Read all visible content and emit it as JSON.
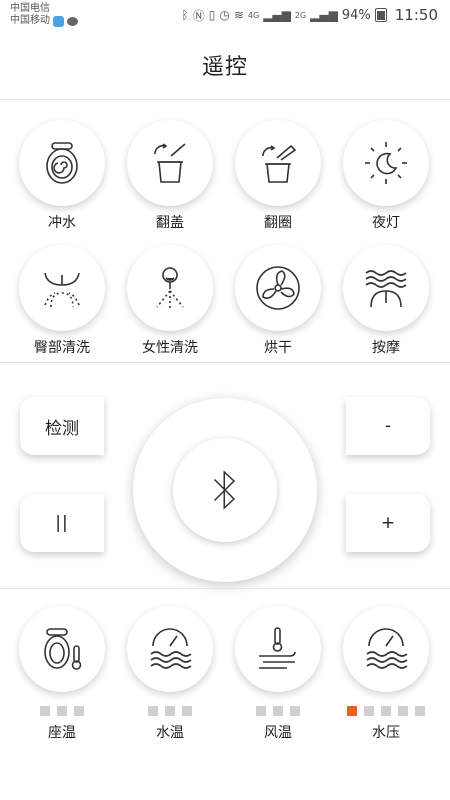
{
  "status_bar": {
    "carrier1": "中国电信",
    "carrier2": "中国移动",
    "network1": "4G",
    "network2": "2G",
    "battery": "94%",
    "time": "11:50"
  },
  "header": {
    "title": "遥控"
  },
  "functions": [
    {
      "label": "冲水",
      "icon": "flush-icon"
    },
    {
      "label": "翻盖",
      "icon": "lid-flip-icon"
    },
    {
      "label": "翻圈",
      "icon": "seat-flip-icon"
    },
    {
      "label": "夜灯",
      "icon": "night-light-icon"
    },
    {
      "label": "臀部清洗",
      "icon": "rear-wash-icon"
    },
    {
      "label": "女性清洗",
      "icon": "feminine-wash-icon"
    },
    {
      "label": "烘干",
      "icon": "fan-dry-icon"
    },
    {
      "label": "按摩",
      "icon": "massage-icon"
    }
  ],
  "controls": {
    "detect_label": "检测",
    "pause_label": "||",
    "minus_label": "-",
    "plus_label": "+",
    "center_icon": "bluetooth-icon"
  },
  "levels": [
    {
      "label": "座温",
      "icon": "seat-temp-icon",
      "max": 3,
      "level": 0
    },
    {
      "label": "水温",
      "icon": "water-temp-icon",
      "max": 3,
      "level": 0
    },
    {
      "label": "风温",
      "icon": "wind-temp-icon",
      "max": 3,
      "level": 0
    },
    {
      "label": "水压",
      "icon": "water-pressure-icon",
      "max": 5,
      "level": 1
    }
  ],
  "colors": {
    "accent": "#e8611e",
    "inactive": "#cfcfcf"
  }
}
